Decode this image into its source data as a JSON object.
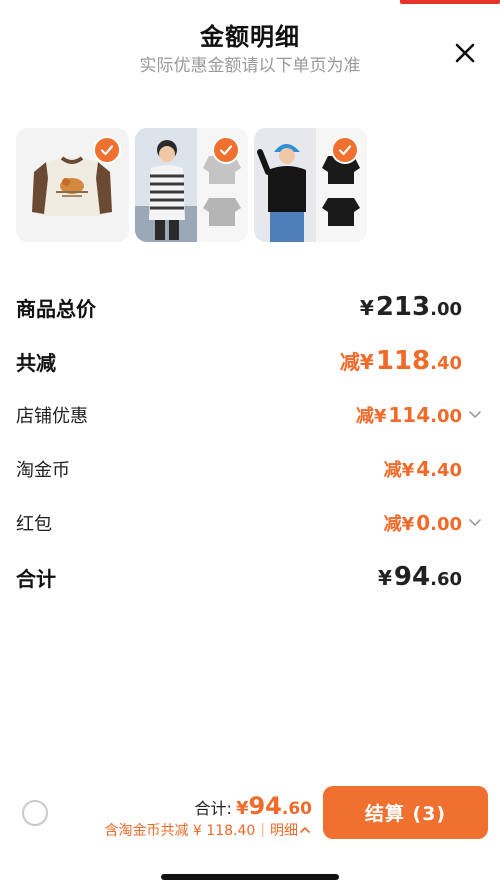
{
  "header": {
    "title": "金额明细",
    "subtitle": "实际优惠金额请以下单页为准"
  },
  "icons": {
    "close": "close-icon",
    "check": "check-icon",
    "chevron": "chevron-down-icon",
    "chevron_up": "chevron-up-icon"
  },
  "colors": {
    "accent": "#f07030",
    "discount_text": "#f06a2a",
    "title_text": "#111111",
    "subtitle_text": "#9a9a9a"
  },
  "products": [
    {
      "name": "brown-raglan-tee",
      "selected": true
    },
    {
      "name": "striped-long-sleeve",
      "selected": true
    },
    {
      "name": "black-turtleneck",
      "selected": true
    }
  ],
  "rows": {
    "total_price": {
      "label": "商品总价",
      "yen": "¥",
      "int": "213",
      "dec": ".00"
    },
    "total_discount": {
      "label": "共减",
      "prefix": "减",
      "yen": "¥",
      "int": "118",
      "dec": ".40"
    },
    "shop_discount": {
      "label": "店铺优惠",
      "prefix": "减",
      "yen": "¥",
      "int": "114",
      "dec": ".00"
    },
    "taojinbi": {
      "label": "淘金币",
      "prefix": "减",
      "yen": "¥",
      "int": "4",
      "dec": ".40"
    },
    "red_packet": {
      "label": "红包",
      "prefix": "减",
      "yen": "¥",
      "int": "0",
      "dec": ".00"
    },
    "grand_total": {
      "label": "合计",
      "yen": "¥",
      "int": "94",
      "dec": ".60"
    }
  },
  "footer": {
    "sum_label": "合计:",
    "sum_yen": "¥",
    "sum_int": "94",
    "sum_dec": ".60",
    "sub_text": "含淘金币共减 ¥ 118.40",
    "separator": "|",
    "detail_label": "明细",
    "checkout_label": "结算 (3)"
  }
}
